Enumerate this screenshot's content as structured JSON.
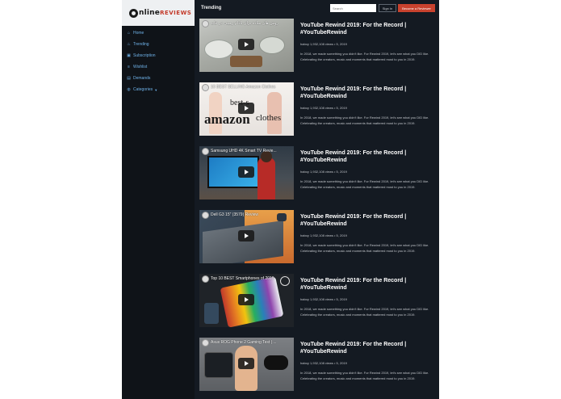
{
  "brand": {
    "logo_main": "nline",
    "logo_accent": "REVIEWS"
  },
  "sidebar": {
    "items": [
      {
        "label": "Home",
        "icon": "home-icon",
        "glyph": "⌂"
      },
      {
        "label": "Trending",
        "icon": "fire-icon",
        "glyph": "♨"
      },
      {
        "label": "Subscription",
        "icon": "subscription-icon",
        "glyph": "▣"
      },
      {
        "label": "Wishlist",
        "icon": "list-icon",
        "glyph": "≡"
      },
      {
        "label": "Demands",
        "icon": "chart-icon",
        "glyph": "▤"
      },
      {
        "label": "Categories",
        "icon": "globe-icon",
        "glyph": "◍",
        "caret": "▼"
      }
    ]
  },
  "header": {
    "title": "Trending",
    "search_placeholder": "Search",
    "signin_label": "Sign In",
    "become_label": "Become a Reviewer"
  },
  "videos": [
    {
      "thumb_title": "روش های ساده برای بادام زمینی در خانه",
      "title": "YouTube Rewind 2019: For the Record | #YouTubeRewind",
      "meta": "haboy 1,932,108 views • 5, 2019",
      "desc": "In 2018, we made something you didn't like. For Rewind 2019, let's see what you DID like. Celebrating the creators, music and moments that mattered most to you in 2019."
    },
    {
      "thumb_title": "10 BEST SELLING Amazon Clothes",
      "thumb_big1": "best-s",
      "thumb_big2": "amazon",
      "thumb_big3": "clothes",
      "title": "YouTube Rewind 2019: For the Record | #YouTubeRewind",
      "meta": "haboy 1,932,108 views • 5, 2019",
      "desc": "In 2018, we made something you didn't like. For Rewind 2019, let's see what you DID like. Celebrating the creators, music and moments that mattered most to you in 2019."
    },
    {
      "thumb_title": "Samsung UHD 4K Smart TV Revie...",
      "title": "YouTube Rewind 2019: For the Record | #YouTubeRewind",
      "meta": "haboy 1,932,108 views • 5, 2019",
      "desc": "In 2018, we made something you didn't like. For Rewind 2019, let's see what you DID like. Celebrating the creators, music and moments that mattered most to you in 2019."
    },
    {
      "thumb_title": "Dell G3 15\" (3579) Review",
      "title": "YouTube Rewind 2019: For the Record | #YouTubeRewind",
      "meta": "haboy 1,932,108 views • 5, 2019",
      "desc": "In 2018, we made something you didn't like. For Rewind 2019, let's see what you DID like. Celebrating the creators, music and moments that mattered most to you in 2019."
    },
    {
      "thumb_title": "Top 10 BEST Smartphones of 2019",
      "title": "YouTube Rewind 2019: For the Record | #YouTubeRewind",
      "meta": "haboy 1,932,108 views • 5, 2019",
      "desc": "In 2018, we made something you didn't like. For Rewind 2019, let's see what you DID like. Celebrating the creators, music and moments that mattered most to you in 2019."
    },
    {
      "thumb_title": "Asus ROG Phone 2 Gaming Test | ...",
      "title": "YouTube Rewind 2019: For the Record | #YouTubeRewind",
      "meta": "haboy 1,932,108 views • 5, 2019",
      "desc": "In 2018, we made something you didn't like. For Rewind 2019, let's see what you DID like. Celebrating the creators, music and moments that mattered most to you in 2019."
    }
  ],
  "colors": {
    "app_bg": "#141a22",
    "sidebar_bg": "#0f1318",
    "accent": "#c8422e",
    "link": "#6fb2e8"
  }
}
